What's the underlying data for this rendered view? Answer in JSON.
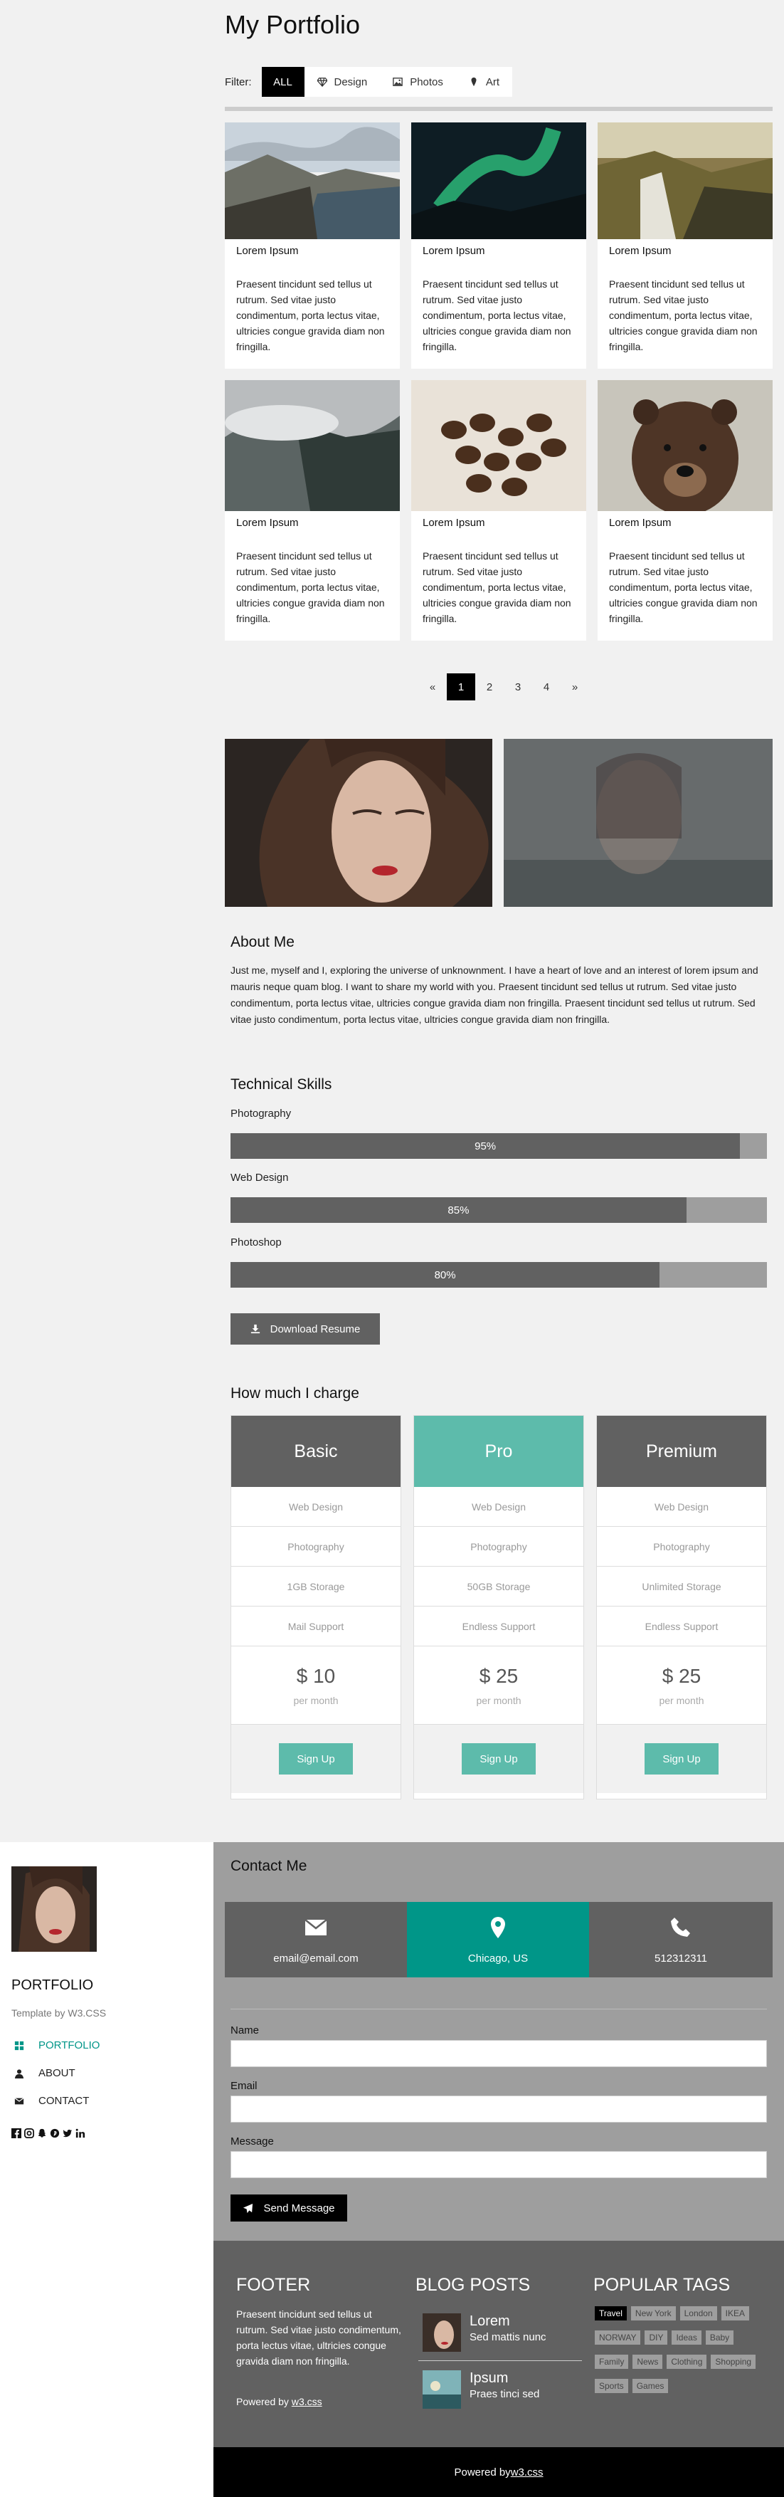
{
  "header": {
    "title": "My Portfolio"
  },
  "filter": {
    "label": "Filter:",
    "buttons": [
      {
        "label": "ALL",
        "icon": "none",
        "active": true
      },
      {
        "label": "Design",
        "icon": "diamond-icon"
      },
      {
        "label": "Photos",
        "icon": "photo-icon"
      },
      {
        "label": "Art",
        "icon": "map-marker-icon"
      }
    ]
  },
  "cards": [
    {
      "title": "Lorem Ipsum",
      "text": "Praesent tincidunt sed tellus ut rutrum. Sed vitae justo condimentum, porta lectus vitae, ultricies congue gravida diam non fringilla."
    },
    {
      "title": "Lorem Ipsum",
      "text": "Praesent tincidunt sed tellus ut rutrum. Sed vitae justo condimentum, porta lectus vitae, ultricies congue gravida diam non fringilla."
    },
    {
      "title": "Lorem Ipsum",
      "text": "Praesent tincidunt sed tellus ut rutrum. Sed vitae justo condimentum, porta lectus vitae, ultricies congue gravida diam non fringilla."
    },
    {
      "title": "Lorem Ipsum",
      "text": "Praesent tincidunt sed tellus ut rutrum. Sed vitae justo condimentum, porta lectus vitae, ultricies congue gravida diam non fringilla."
    },
    {
      "title": "Lorem Ipsum",
      "text": "Praesent tincidunt sed tellus ut rutrum. Sed vitae justo condimentum, porta lectus vitae, ultricies congue gravida diam non fringilla."
    },
    {
      "title": "Lorem Ipsum",
      "text": "Praesent tincidunt sed tellus ut rutrum. Sed vitae justo condimentum, porta lectus vitae, ultricies congue gravida diam non fringilla."
    }
  ],
  "pagination": {
    "items": [
      "«",
      "1",
      "2",
      "3",
      "4",
      "»"
    ],
    "active": "1"
  },
  "about": {
    "title": "About Me",
    "text": "Just me, myself and I, exploring the universe of unknownment. I have a heart of love and an interest of lorem ipsum and mauris neque quam blog. I want to share my world with you. Praesent tincidunt sed tellus ut rutrum. Sed vitae justo condimentum, porta lectus vitae, ultricies congue gravida diam non fringilla. Praesent tincidunt sed tellus ut rutrum. Sed vitae justo condimentum, porta lectus vitae, ultricies congue gravida diam non fringilla."
  },
  "skills": {
    "title": "Technical Skills",
    "items": [
      {
        "label": "Photography",
        "value": "95%",
        "percent": 95
      },
      {
        "label": "Web Design",
        "value": "85%",
        "percent": 85
      },
      {
        "label": "Photoshop",
        "value": "80%",
        "percent": 80
      }
    ],
    "download_label": "Download Resume"
  },
  "pricing": {
    "title": "How much I charge",
    "plans": [
      {
        "name": "Basic",
        "features": [
          "Web Design",
          "Photography",
          "1GB Storage",
          "Mail Support"
        ],
        "price": "$ 10",
        "period": "per month",
        "cta": "Sign Up"
      },
      {
        "name": "Pro",
        "features": [
          "Web Design",
          "Photography",
          "50GB Storage",
          "Endless Support"
        ],
        "price": "$ 25",
        "period": "per month",
        "cta": "Sign Up"
      },
      {
        "name": "Premium",
        "features": [
          "Web Design",
          "Photography",
          "Unlimited Storage",
          "Endless Support"
        ],
        "price": "$ 25",
        "period": "per month",
        "cta": "Sign Up"
      }
    ]
  },
  "sidebar": {
    "title": "PORTFOLIO",
    "subtitle": "Template by W3.CSS",
    "nav": [
      {
        "label": "PORTFOLIO",
        "icon": "grid-icon",
        "active": true
      },
      {
        "label": "ABOUT",
        "icon": "user-icon"
      },
      {
        "label": "CONTACT",
        "icon": "envelope-icon"
      }
    ],
    "social_icons": [
      "facebook-icon",
      "instagram-icon",
      "snapchat-icon",
      "pinterest-icon",
      "twitter-icon",
      "linkedin-icon"
    ]
  },
  "contact": {
    "title": "Contact Me",
    "email": "email@email.com",
    "location": "Chicago, US",
    "phone": "512312311",
    "fields": {
      "name": "Name",
      "email": "Email",
      "message": "Message"
    },
    "send_label": "Send Message"
  },
  "footer": {
    "title": "FOOTER",
    "text": "Praesent tincidunt sed tellus ut rutrum. Sed vitae justo condimentum, porta lectus vitae, ultricies congue gravida diam non fringilla.",
    "powered_prefix": "Powered by ",
    "powered_link": "w3.css",
    "blog_title": "BLOG POSTS",
    "blog": [
      {
        "title": "Lorem",
        "subtitle": "Sed mattis nunc"
      },
      {
        "title": "Ipsum",
        "subtitle": "Praes tinci sed"
      }
    ],
    "tags_title": "POPULAR TAGS",
    "tags": [
      "Travel",
      "New York",
      "London",
      "IKEA",
      "NORWAY",
      "DIY",
      "Ideas",
      "Baby",
      "Family",
      "News",
      "Clothing",
      "Shopping",
      "Sports",
      "Games"
    ]
  },
  "bottom": {
    "prefix": "Powered by ",
    "link": "w3.css"
  },
  "colors": {
    "accent": "#009688",
    "teal_light": "#5dbbab",
    "dark_gray": "#616161",
    "mid_gray": "#9e9e9e"
  }
}
